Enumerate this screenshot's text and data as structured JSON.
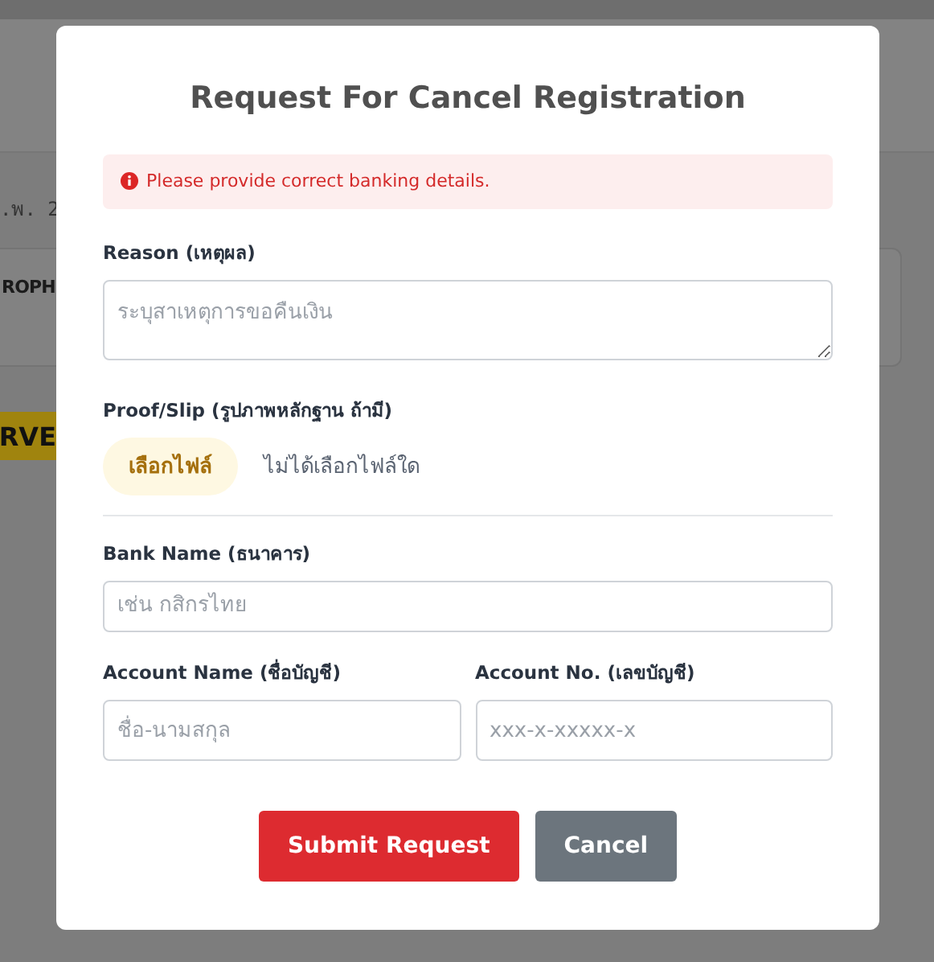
{
  "background_page": {
    "date_fragment": ".พ. 2",
    "card_text": "ROPH",
    "badge_text": "RVE"
  },
  "dialog": {
    "title": "Request For Cancel Registration",
    "alert": {
      "text": "Please provide correct banking details."
    },
    "reason": {
      "label": "Reason (เหตุผล)",
      "placeholder": "ระบุสาเหตุการขอคืนเงิน"
    },
    "proof": {
      "label": "Proof/Slip (รูปภาพหลักฐาน ถ้ามี)",
      "button": "เลือกไฟล์",
      "status": "ไม่ได้เลือกไฟล์ใด"
    },
    "bank_name": {
      "label": "Bank Name (ธนาคาร)",
      "placeholder": "เช่น กสิกรไทย"
    },
    "account_name": {
      "label": "Account Name (ชื่อบัญชี)",
      "placeholder": "ชื่อ-นามสกุล"
    },
    "account_no": {
      "label": "Account No. (เลขบัญชี)",
      "placeholder": "xxx-x-xxxxx-x"
    },
    "buttons": [
      {
        "label": "Submit Request",
        "kind": "primary"
      },
      {
        "label": "Cancel",
        "kind": "secondary"
      }
    ]
  }
}
